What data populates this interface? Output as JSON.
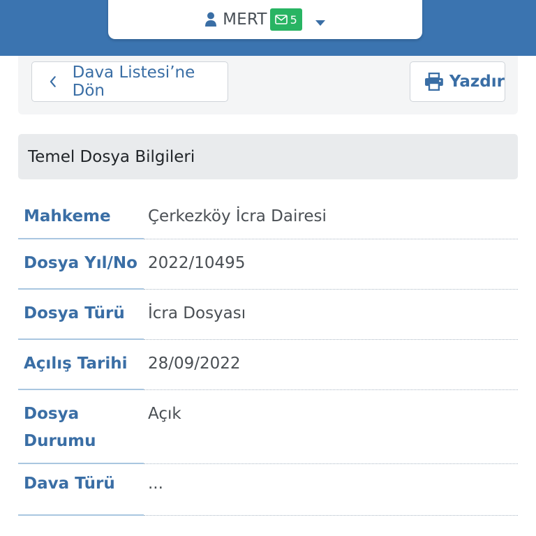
{
  "header": {
    "user_name": "MERT",
    "mail_count": "5",
    "icons": {
      "user": "user-icon",
      "mail": "envelope-icon",
      "caret": "caret-down-icon"
    },
    "colors": {
      "bar": "#3b74b0",
      "badge": "#28b463"
    }
  },
  "actions": {
    "back_label": "Dava Listesi’ne Dön",
    "print_label": "Yazdır",
    "icons": {
      "back": "chevron-left-icon",
      "print": "printer-icon"
    }
  },
  "section": {
    "title": "Temel Dosya Bilgileri"
  },
  "info": [
    {
      "label": "Mahkeme",
      "value": "Çerkezköy İcra Dairesi"
    },
    {
      "label": "Dosya Yıl/No",
      "value": "2022/10495"
    },
    {
      "label": "Dosya Türü",
      "value": "İcra Dosyası"
    },
    {
      "label": "Açılış Tarihi",
      "value": "28/09/2022"
    },
    {
      "label": "Dosya Durumu",
      "value": "Açık"
    },
    {
      "label": "Dava Türü",
      "value": "..."
    }
  ]
}
